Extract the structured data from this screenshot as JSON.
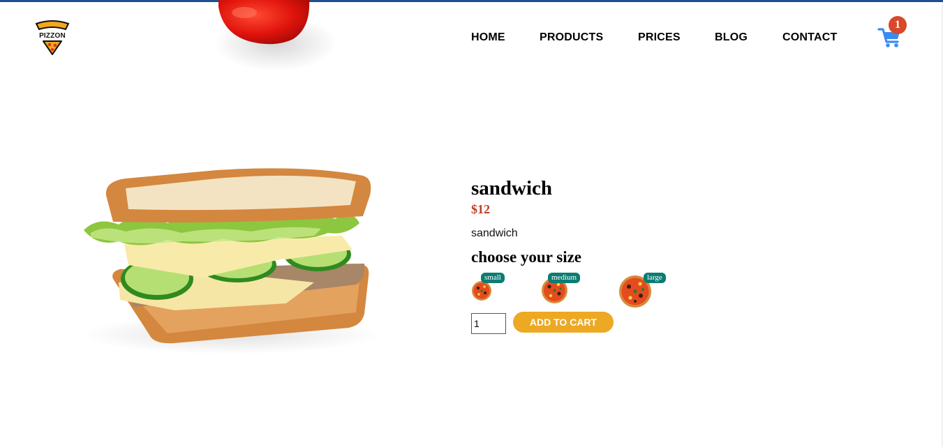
{
  "header": {
    "logo_text": "PIZZON",
    "nav": [
      {
        "label": "HOME"
      },
      {
        "label": "PRODUCTS"
      },
      {
        "label": "PRICES"
      },
      {
        "label": "BLOG"
      },
      {
        "label": "CONTACT"
      }
    ],
    "cart": {
      "count": "1",
      "icon": "shopping-cart-icon",
      "color": "#3b8cf0",
      "badge_color": "#d9482b"
    }
  },
  "product": {
    "title": "sandwich",
    "price": "$12",
    "description": "sandwich",
    "size_heading": "choose your size",
    "sizes": [
      {
        "label": "small"
      },
      {
        "label": "medium"
      },
      {
        "label": "large"
      }
    ],
    "quantity": "1",
    "add_to_cart_label": "ADD TO CART"
  },
  "colors": {
    "price": "#c23b22",
    "size_badge": "#0d7c73",
    "add_button": "#eda923",
    "top_strip": "#1e4f8f"
  }
}
